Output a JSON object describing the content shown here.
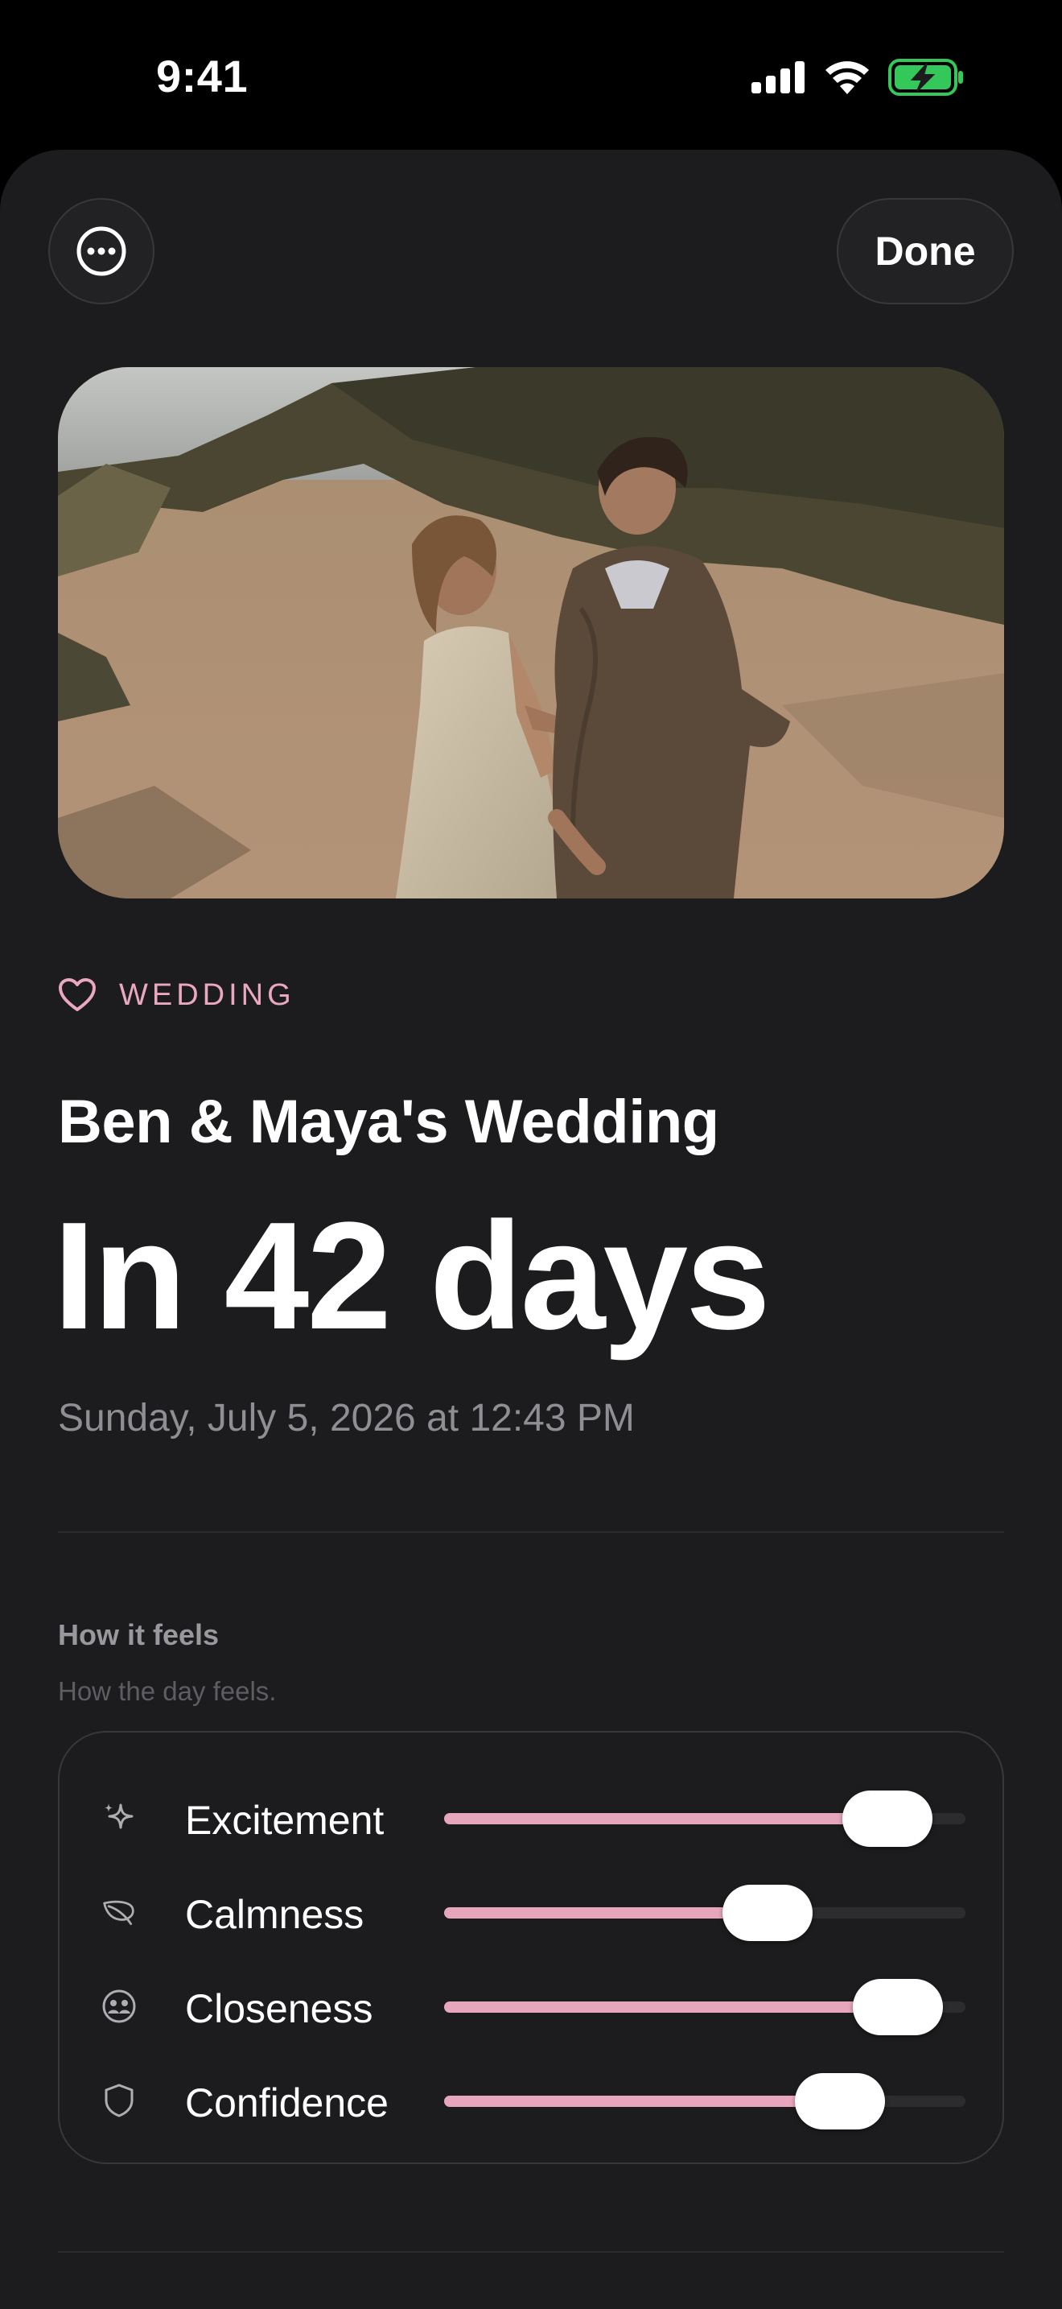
{
  "status_bar": {
    "time": "9:41"
  },
  "header": {
    "more_icon": "ellipsis-circle-icon",
    "done_label": "Done"
  },
  "event": {
    "category_icon": "heart-icon",
    "category": "WEDDING",
    "title": "Ben & Maya's Wedding",
    "countdown": "In 42 days",
    "date": "Sunday, July 5, 2026 at 12:43 PM"
  },
  "feelings": {
    "title": "How it feels",
    "subtitle": "How the day feels.",
    "items": [
      {
        "label": "Excitement",
        "icon": "sparkles-icon",
        "value": 0.85
      },
      {
        "label": "Calmness",
        "icon": "leaf-icon",
        "value": 0.62
      },
      {
        "label": "Closeness",
        "icon": "people-icon",
        "value": 0.87
      },
      {
        "label": "Confidence",
        "icon": "shield-icon",
        "value": 0.76
      }
    ]
  },
  "colors": {
    "accent": "#e7a6bb",
    "background": "#1c1c1e",
    "battery": "#34c759"
  }
}
